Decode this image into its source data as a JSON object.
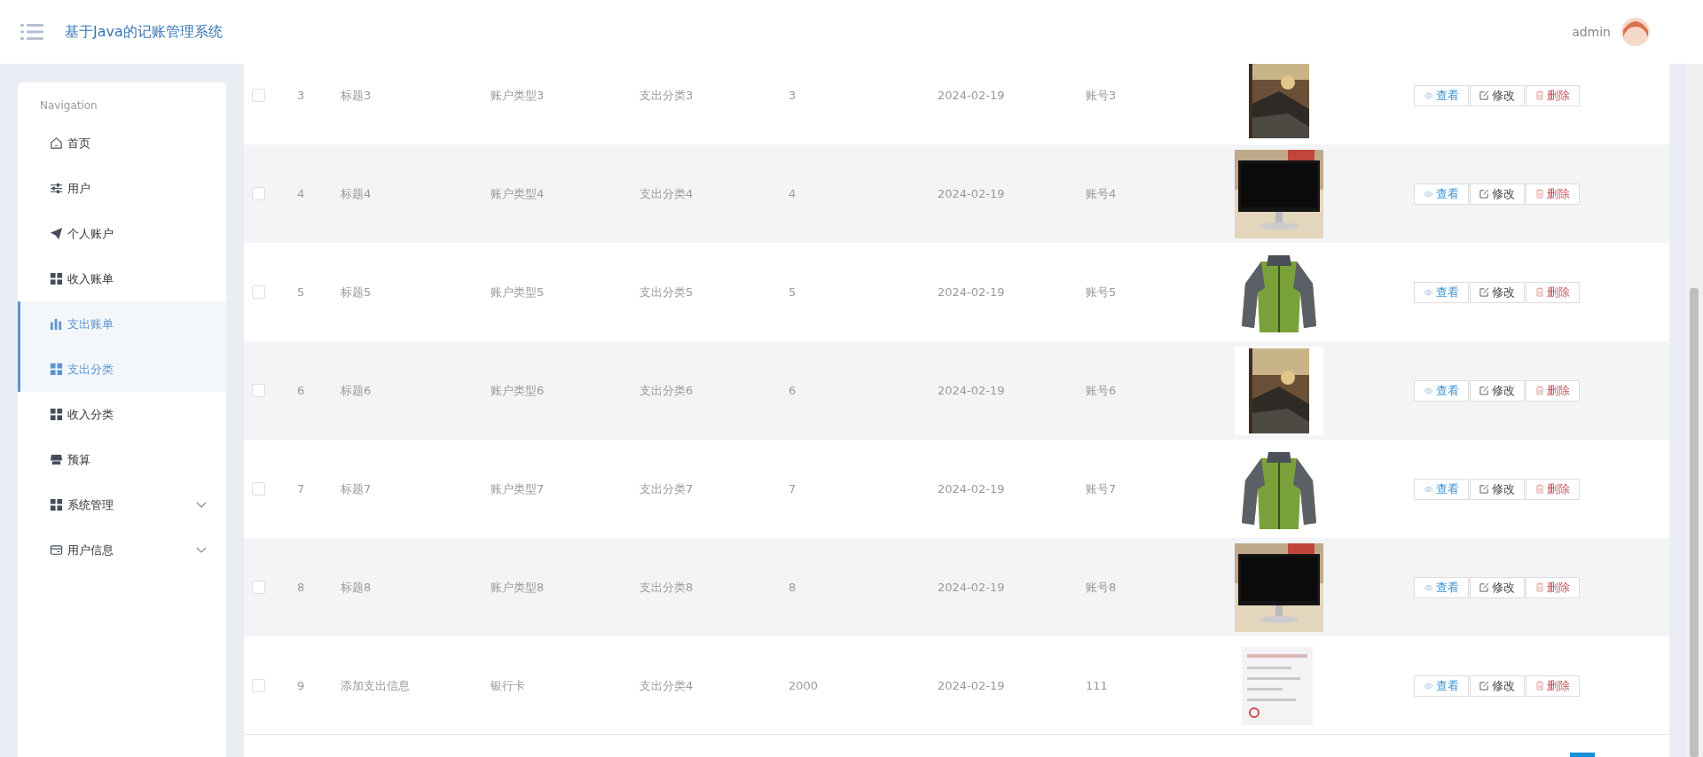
{
  "header": {
    "title": "基于Java的记账管理系统",
    "user": "admin"
  },
  "sidebar": {
    "heading": "Navigation",
    "items": [
      {
        "label": "首页",
        "selected": false
      },
      {
        "label": "用户",
        "selected": false
      },
      {
        "label": "个人账户",
        "selected": false
      },
      {
        "label": "收入账单",
        "selected": false
      },
      {
        "label": "支出账单",
        "selected": true
      },
      {
        "label": "支出分类",
        "selected": true
      },
      {
        "label": "收入分类",
        "selected": false
      },
      {
        "label": "预算",
        "selected": false
      },
      {
        "label": "系统管理",
        "selected": false,
        "expanded": false
      },
      {
        "label": "用户信息",
        "selected": false,
        "expanded": false
      }
    ]
  },
  "table": {
    "rows": [
      {
        "checked": false,
        "index": "3",
        "title": "标题3",
        "account_type": "账户类型3",
        "category": "支出分类3",
        "amount": "3",
        "date": "2024-02-19",
        "account": "账号3",
        "actions": [
          {
            "kind": "view",
            "label": "查看"
          },
          {
            "kind": "edit",
            "label": "修改"
          },
          {
            "kind": "delete",
            "label": "删除"
          }
        ]
      },
      {
        "checked": false,
        "index": "4",
        "title": "标题4",
        "account_type": "账户类型4",
        "category": "支出分类4",
        "amount": "4",
        "date": "2024-02-19",
        "account": "账号4",
        "actions": [
          {
            "kind": "view",
            "label": "查看"
          },
          {
            "kind": "edit",
            "label": "修改"
          },
          {
            "kind": "delete",
            "label": "删除"
          }
        ]
      },
      {
        "checked": false,
        "index": "5",
        "title": "标题5",
        "account_type": "账户类型5",
        "category": "支出分类5",
        "amount": "5",
        "date": "2024-02-19",
        "account": "账号5",
        "actions": [
          {
            "kind": "view",
            "label": "查看"
          },
          {
            "kind": "edit",
            "label": "修改"
          },
          {
            "kind": "delete",
            "label": "删除"
          }
        ]
      },
      {
        "checked": false,
        "index": "6",
        "title": "标题6",
        "account_type": "账户类型6",
        "category": "支出分类6",
        "amount": "6",
        "date": "2024-02-19",
        "account": "账号6",
        "actions": [
          {
            "kind": "view",
            "label": "查看"
          },
          {
            "kind": "edit",
            "label": "修改"
          },
          {
            "kind": "delete",
            "label": "删除"
          }
        ]
      },
      {
        "checked": false,
        "index": "7",
        "title": "标题7",
        "account_type": "账户类型7",
        "category": "支出分类7",
        "amount": "7",
        "date": "2024-02-19",
        "account": "账号7",
        "actions": [
          {
            "kind": "view",
            "label": "查看"
          },
          {
            "kind": "edit",
            "label": "修改"
          },
          {
            "kind": "delete",
            "label": "删除"
          }
        ]
      },
      {
        "checked": false,
        "index": "8",
        "title": "标题8",
        "account_type": "账户类型8",
        "category": "支出分类8",
        "amount": "8",
        "date": "2024-02-19",
        "account": "账号8",
        "actions": [
          {
            "kind": "view",
            "label": "查看"
          },
          {
            "kind": "edit",
            "label": "修改"
          },
          {
            "kind": "delete",
            "label": "删除"
          }
        ]
      },
      {
        "checked": false,
        "index": "9",
        "title": "添加支出信息",
        "account_type": "银行卡",
        "category": "支出分类4",
        "amount": "2000",
        "date": "2024-02-19",
        "account": "111",
        "actions": [
          {
            "kind": "view",
            "label": "查看"
          },
          {
            "kind": "edit",
            "label": "修改"
          },
          {
            "kind": "delete",
            "label": "删除"
          }
        ]
      }
    ]
  }
}
